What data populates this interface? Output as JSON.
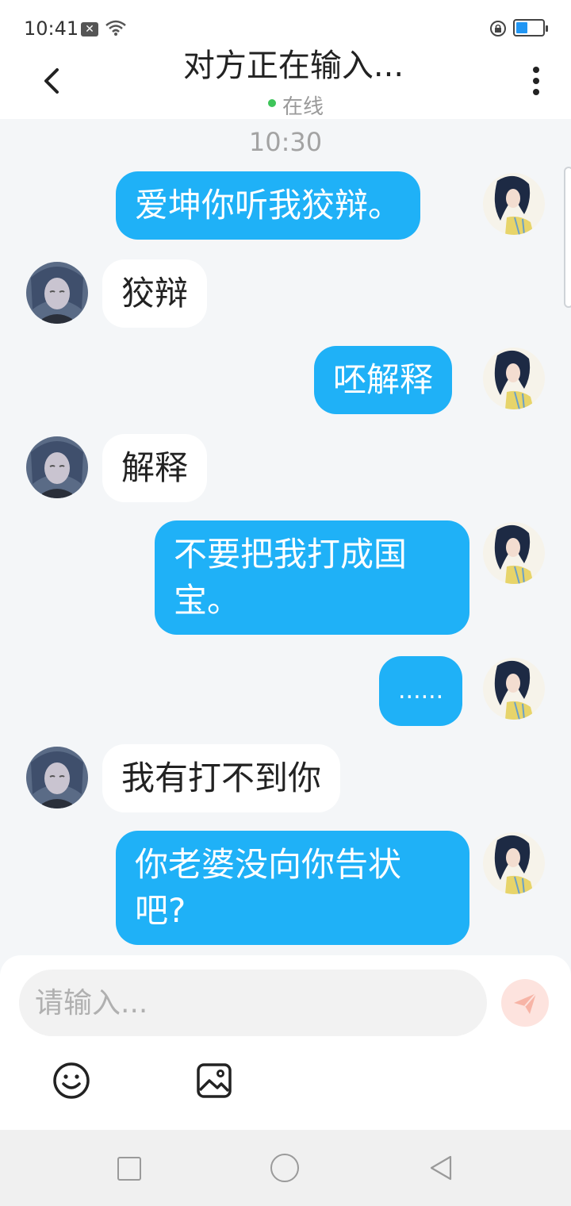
{
  "status_bar": {
    "time": "10:41"
  },
  "header": {
    "title": "对方正在输入...",
    "status": "在线"
  },
  "chat": {
    "timestamp": "10:30",
    "messages": [
      {
        "side": "sent",
        "text": "爱坤你听我狡辩。"
      },
      {
        "side": "received",
        "text": "狡辩"
      },
      {
        "side": "sent",
        "text": "呸解释"
      },
      {
        "side": "received",
        "text": "解释"
      },
      {
        "side": "sent",
        "lines": [
          "不要把我打成国",
          "宝。"
        ]
      },
      {
        "side": "sent",
        "text": "......"
      },
      {
        "side": "received",
        "text": "我有打不到你"
      },
      {
        "side": "sent",
        "lines": [
          "你老婆没向你告状",
          "吧?"
        ]
      }
    ]
  },
  "composer": {
    "placeholder": "请输入..."
  },
  "icons": {
    "back": "chevron-left-icon",
    "more": "more-vertical-icon",
    "send": "send-icon",
    "emoji": "emoji-icon",
    "image": "image-icon"
  },
  "colors": {
    "sent_bubble": "#1fb1f7",
    "received_bubble": "#ffffff",
    "background": "#f4f6f8",
    "online_dot": "#3ec55a",
    "send_button": "#fde3de"
  }
}
